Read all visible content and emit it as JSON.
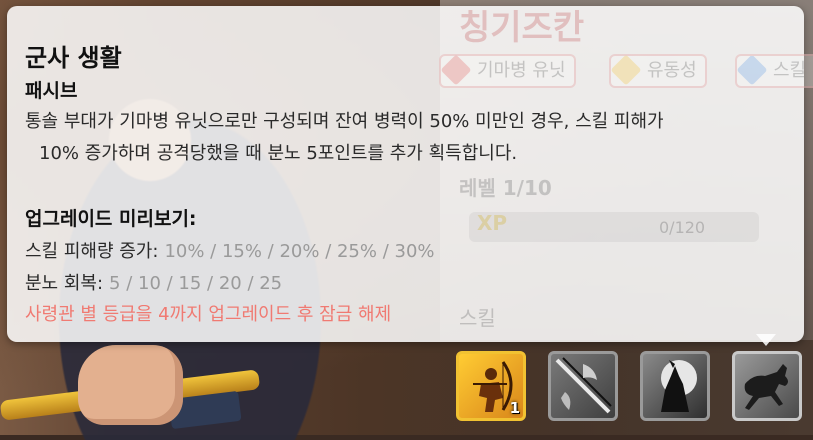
{
  "background": {
    "hero_name": "칭기즈칸",
    "badges": [
      {
        "label": "기마병 유닛",
        "icon": "horse-icon"
      },
      {
        "label": "유동성",
        "icon": "arrows-icon"
      },
      {
        "label": "스킬",
        "icon": "star-icon"
      }
    ],
    "level_text": "레벨 1/10",
    "xp_text": "0/120",
    "xp_label": "XP",
    "skills_heading": "스킬"
  },
  "tooltip": {
    "title": "군사 생활",
    "type": "패시브",
    "description_line1": "통솔 부대가 기마병 유닛으로만 구성되며 잔여 병력이 50% 미만인 경우, 스킬 피해가",
    "description_line2": "10% 증가하며 공격당했을 때 분노 5포인트를 추가 획득합니다.",
    "upgrade_heading": "업그레이드 미리보기:",
    "upgrade_rows": [
      {
        "label": "스킬 피해량 증가:",
        "values": "10% / 15% / 20% / 25% / 30%"
      },
      {
        "label": "분노 회복:",
        "values": "5 / 10 / 15 / 20 / 25"
      }
    ],
    "unlock_note": "사령관 별 등급을 4까지 업그레이드 후 잠금 해제"
  },
  "skills": [
    {
      "name": "archer-skill",
      "icon": "archer-icon",
      "level": "1",
      "unlocked": true
    },
    {
      "name": "slash-skill",
      "icon": "crossed-blades-icon",
      "level": "",
      "unlocked": false
    },
    {
      "name": "wolf-skill",
      "icon": "howling-wolf-icon",
      "level": "",
      "unlocked": false
    },
    {
      "name": "horse-skill",
      "icon": "galloping-horse-icon",
      "level": "",
      "unlocked": false,
      "selected": true
    }
  ],
  "colors": {
    "unlock_note": "#f07a72",
    "upgrade_values": "#9a9a9a",
    "active_skill_border": "#f1c232"
  }
}
